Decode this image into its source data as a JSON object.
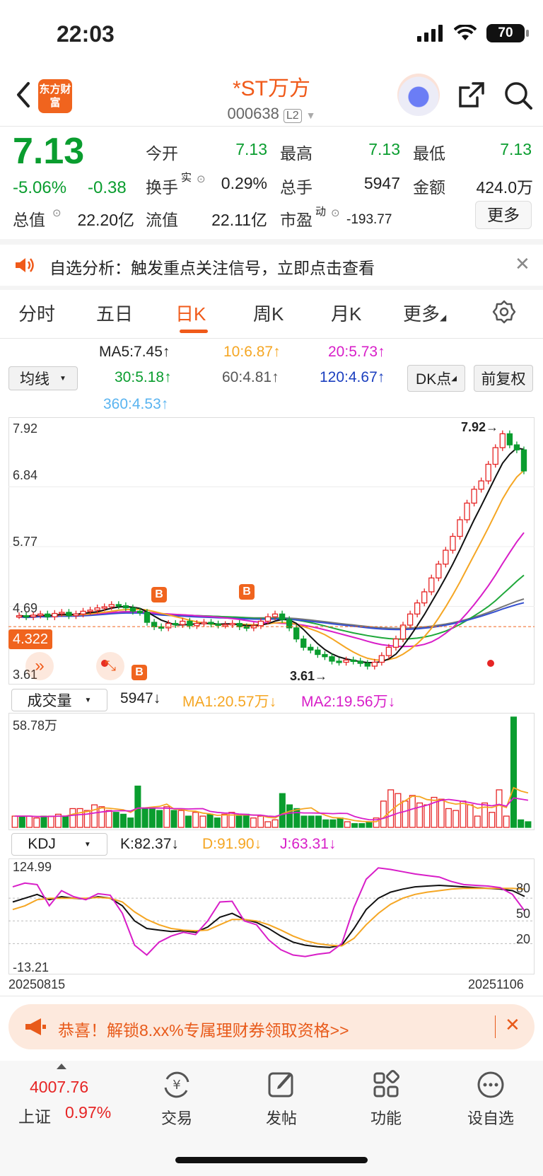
{
  "status_bar": {
    "time": "22:03",
    "battery": "70"
  },
  "header": {
    "logo_text": "东方财富",
    "title": "*ST万方",
    "code": "000638",
    "level_badge": "L2"
  },
  "quote": {
    "price": "7.13",
    "change_pct": "-5.06%",
    "change": "-0.38",
    "open_label": "今开",
    "open": "7.13",
    "high_label": "最高",
    "high": "7.13",
    "low_label": "最低",
    "low": "7.13",
    "turnover_label": "换手",
    "turnover_sup": "实",
    "turnover": "0.29%",
    "volume_label": "总手",
    "volume": "5947",
    "amount_label": "金额",
    "amount": "424.0万",
    "total_cap_label": "总值",
    "total_cap": "22.20亿",
    "float_cap_label": "流值",
    "float_cap": "22.11亿",
    "pe_label": "市盈",
    "pe_sup": "动",
    "pe": "-193.77",
    "more_label": "更多"
  },
  "notice": {
    "text": "自选分析：触发重点关注信号，立即点击查看"
  },
  "tabs": [
    "分时",
    "五日",
    "日K",
    "周K",
    "月K",
    "更多"
  ],
  "ma_legend": {
    "ma5": "MA5:7.45↑",
    "ma10": "10:6.87↑",
    "ma20": "20:5.73↑",
    "ma30": "30:5.18↑",
    "ma60": "60:4.81↑",
    "ma120": "120:4.67↑",
    "ma360": "360:4.53↑",
    "select_label": "均线",
    "dk_label": "DK点",
    "adjust_label": "前复权"
  },
  "price_chart": {
    "y_labels": [
      "7.92",
      "6.84",
      "5.77",
      "4.69",
      "3.61"
    ],
    "current_price_tag": "4.322",
    "max_marker": "7.92→",
    "min_marker": "3.61→",
    "b_marker": "B"
  },
  "volume_row": {
    "select_label": "成交量",
    "vol": "5947↓",
    "ma1": "MA1:20.57万↓",
    "ma2": "MA2:19.56万↓",
    "max_label": "58.78万"
  },
  "kdj_row": {
    "select_label": "KDJ",
    "k": "K:82.37↓",
    "d": "D:91.90↓",
    "j": "J:63.31↓",
    "max_label": "124.99",
    "min_label": "-13.21",
    "l80": "80",
    "l50": "50",
    "l20": "20"
  },
  "dates": {
    "start": "20250815",
    "end": "20251106"
  },
  "banner": {
    "text": "恭喜！解锁8.xx%专属理财券领取资格>>"
  },
  "bottom_nav": {
    "index_value": "4007.76",
    "index_name": "上证",
    "index_change": "0.97%",
    "trade": "交易",
    "post": "发帖",
    "functions": "功能",
    "watchlist": "设自选"
  },
  "colors": {
    "brand": "#f05a1a",
    "up": "#e62525",
    "down": "#0a9d2f",
    "ma10": "#f5a623",
    "ma20": "#d81ec8"
  },
  "chart_data": [
    {
      "type": "candlestick",
      "title": "",
      "x_range": [
        "20250815",
        "20251106"
      ],
      "ylim": [
        3.61,
        7.92
      ],
      "closes": [
        4.52,
        4.5,
        4.53,
        4.55,
        4.5,
        4.56,
        4.58,
        4.52,
        4.55,
        4.6,
        4.62,
        4.66,
        4.68,
        4.72,
        4.7,
        4.66,
        4.6,
        4.58,
        4.4,
        4.32,
        4.3,
        4.38,
        4.36,
        4.42,
        4.34,
        4.38,
        4.4,
        4.37,
        4.35,
        4.36,
        4.38,
        4.32,
        4.3,
        4.34,
        4.42,
        4.5,
        4.55,
        4.45,
        4.3,
        4.1,
        3.95,
        3.9,
        3.82,
        3.78,
        3.7,
        3.68,
        3.72,
        3.7,
        3.66,
        3.61,
        3.68,
        3.8,
        3.95,
        4.1,
        4.35,
        4.55,
        4.75,
        4.95,
        5.2,
        5.45,
        5.7,
        5.95,
        6.25,
        6.55,
        6.8,
        6.95,
        7.25,
        7.55,
        7.8,
        7.6,
        7.51,
        7.13
      ]
    },
    {
      "type": "bar",
      "title": "成交量",
      "ylim": [
        0,
        58.78
      ],
      "values": [
        6,
        6,
        6,
        5,
        6,
        6,
        7,
        6,
        10,
        10,
        9,
        12,
        11,
        9,
        8,
        7,
        5,
        22,
        10,
        10,
        9,
        11,
        9,
        9,
        6,
        8,
        6,
        7,
        5,
        7,
        8,
        6,
        7,
        5,
        6,
        3,
        4,
        18,
        12,
        10,
        6,
        6,
        6,
        4,
        4,
        5,
        3,
        2,
        2,
        3,
        5,
        14,
        20,
        18,
        14,
        17,
        13,
        12,
        16,
        15,
        10,
        9,
        14,
        12,
        6,
        13,
        8,
        20,
        6,
        58.78,
        4,
        3
      ]
    },
    {
      "type": "line",
      "title": "KDJ",
      "ylim": [
        -13.21,
        124.99
      ],
      "series": [
        {
          "name": "K",
          "values": [
            75,
            80,
            85,
            78,
            82,
            80,
            79,
            82,
            80,
            70,
            50,
            40,
            38,
            36,
            37,
            35,
            42,
            55,
            60,
            52,
            48,
            40,
            30,
            22,
            18,
            16,
            15,
            18,
            40,
            65,
            80,
            88,
            92,
            95,
            96,
            97,
            96,
            95,
            94,
            93,
            92,
            90,
            82.37
          ]
        },
        {
          "name": "D",
          "values": [
            65,
            70,
            78,
            80,
            80,
            80,
            80,
            81,
            80,
            75,
            62,
            52,
            45,
            40,
            38,
            37,
            38,
            45,
            52,
            52,
            50,
            45,
            38,
            30,
            24,
            20,
            18,
            17,
            27,
            45,
            60,
            72,
            80,
            85,
            88,
            90,
            92,
            93,
            93,
            93,
            93,
            93,
            91.9
          ]
        },
        {
          "name": "J",
          "values": [
            95,
            100,
            98,
            70,
            90,
            82,
            78,
            86,
            84,
            60,
            18,
            5,
            22,
            30,
            35,
            32,
            50,
            75,
            76,
            50,
            45,
            25,
            12,
            5,
            3,
            6,
            8,
            20,
            68,
            105,
            120,
            118,
            115,
            112,
            110,
            108,
            102,
            98,
            97,
            96,
            94,
            85,
            63.31
          ]
        }
      ]
    }
  ]
}
